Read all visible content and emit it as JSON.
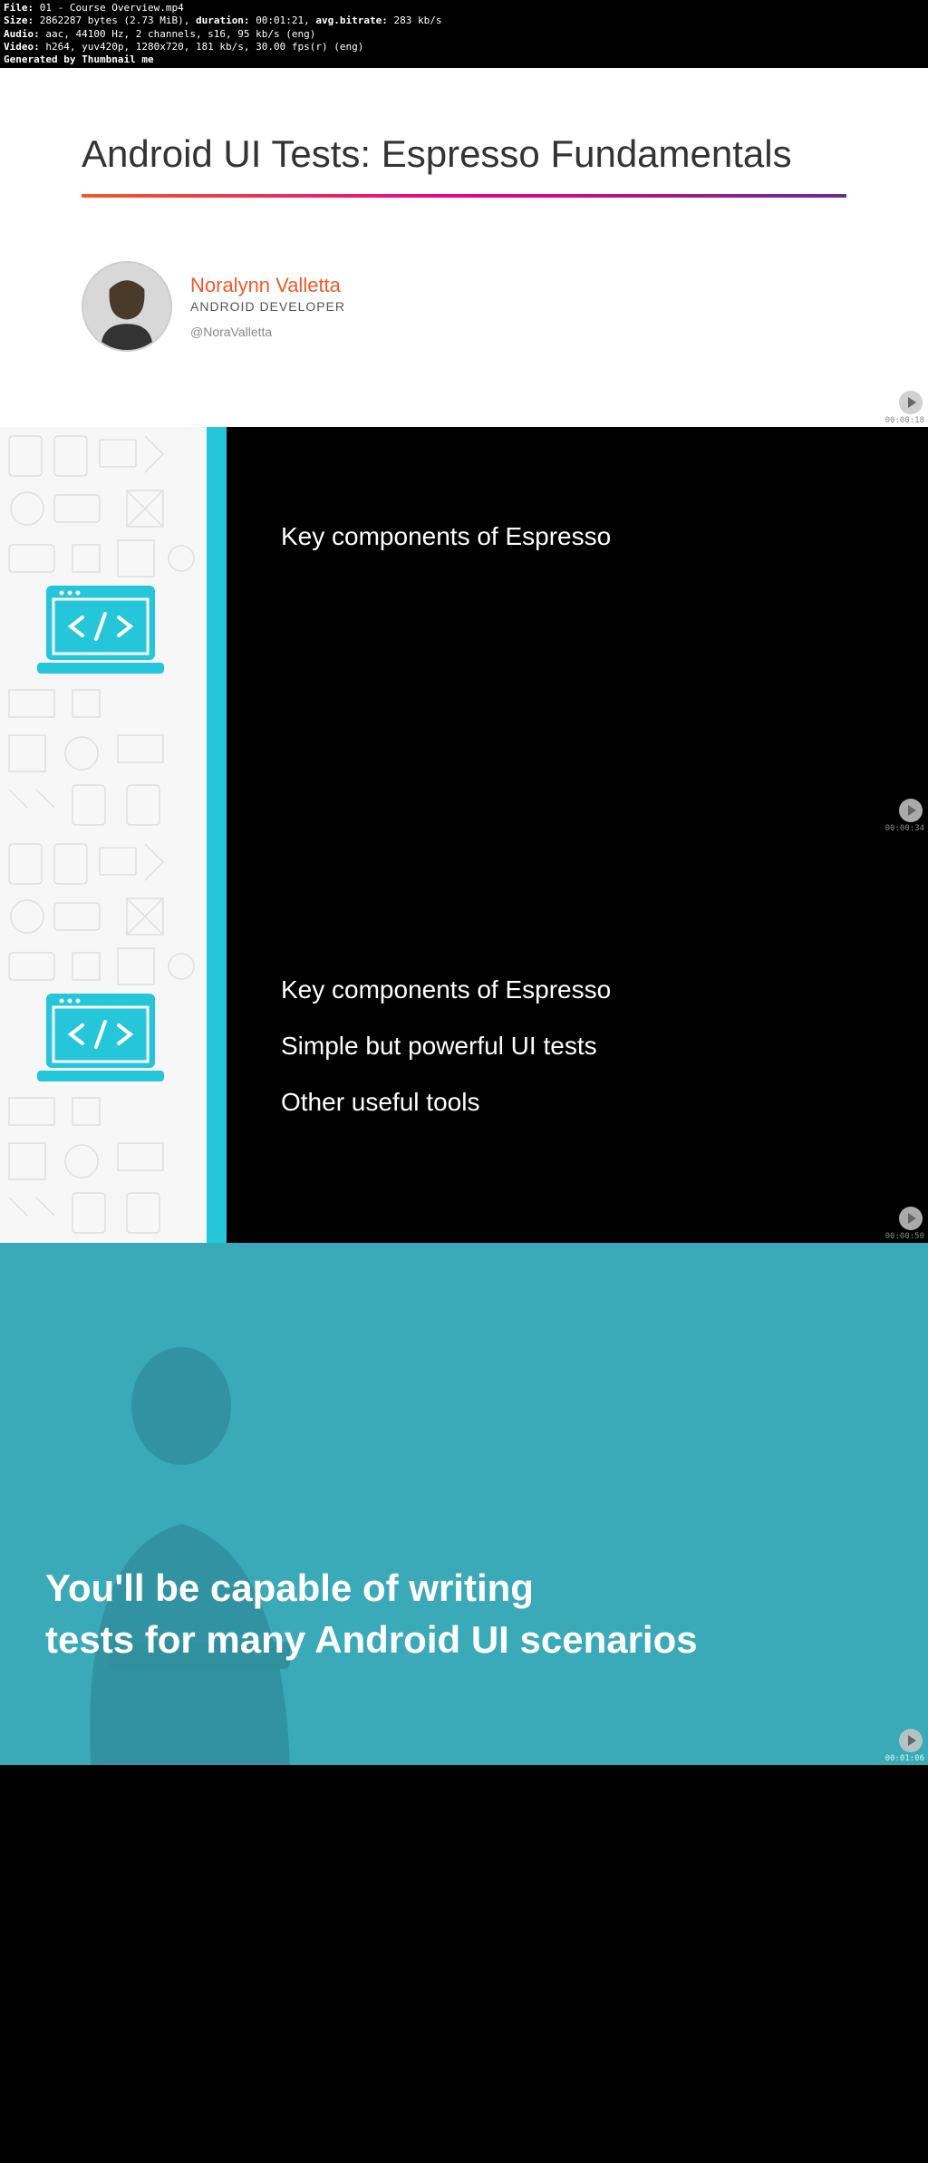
{
  "metadata": {
    "file_label": "File:",
    "file_value": "01 - Course Overview.mp4",
    "size_label": "Size:",
    "size_bytes": "2862287",
    "size_unit": "bytes (2.73 MiB),",
    "duration_label": "duration:",
    "duration_value": "00:01:21,",
    "bitrate_label": "avg.bitrate:",
    "bitrate_value": "283 kb/s",
    "audio_label": "Audio:",
    "audio_value": "aac, 44100 Hz, 2 channels, s16, 95 kb/s (eng)",
    "video_label": "Video:",
    "video_value": "h264, yuv420p, 1280x720, 181 kb/s, 30.00 fps(r) (eng)",
    "generated": "Generated by Thumbnail me"
  },
  "slide1": {
    "title": "Android UI Tests: Espresso Fundamentals",
    "author_name": "Noralynn Valletta",
    "author_role": "ANDROID DEVELOPER",
    "author_handle": "@NoraValletta",
    "timecode": "00:00:18"
  },
  "slide2": {
    "bullets": [
      "Key components of Espresso"
    ],
    "timecode": "00:00:34"
  },
  "slide3": {
    "bullets": [
      "Key components of Espresso",
      "Simple but powerful UI tests",
      "Other useful tools"
    ],
    "timecode": "00:00:50"
  },
  "slide4": {
    "caption_line1": "You'll be capable of writing",
    "caption_line2": "tests for many Android UI scenarios",
    "timecode": "00:01:06"
  }
}
